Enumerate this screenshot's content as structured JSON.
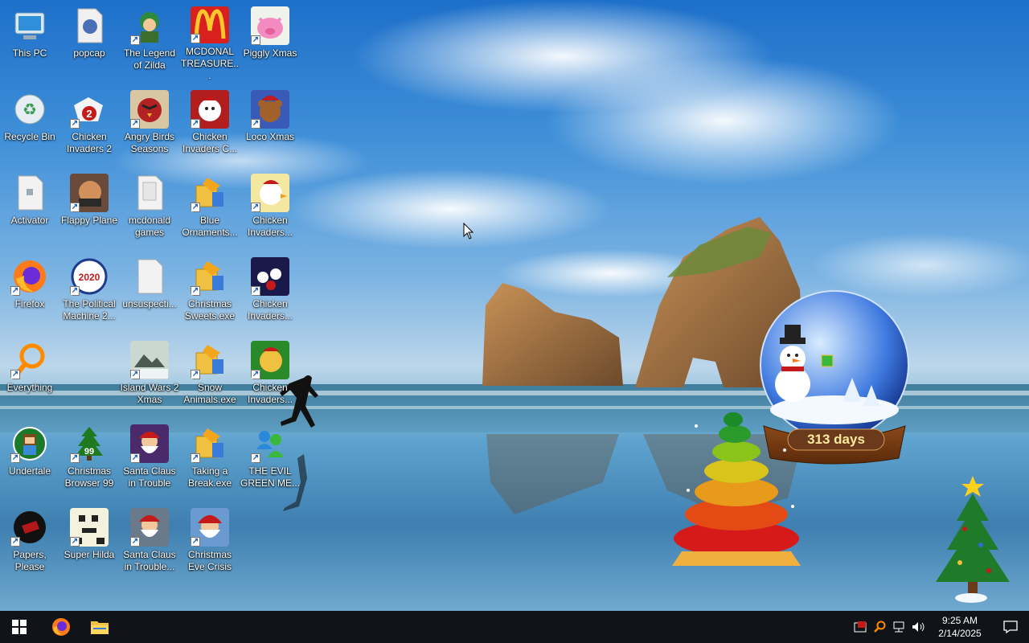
{
  "desktop_icons": [
    {
      "label": "This PC"
    },
    {
      "label": "popcap"
    },
    {
      "label": "The Legend of Zilda"
    },
    {
      "label": "MCDONAL TREASURE..."
    },
    {
      "label": "Piggly Xmas"
    },
    {
      "label": "Recycle Bin"
    },
    {
      "label": "Chicken Invaders 2"
    },
    {
      "label": "Angry Birds Seasons"
    },
    {
      "label": "Chicken Invaders C..."
    },
    {
      "label": "Loco Xmas"
    },
    {
      "label": "Activator"
    },
    {
      "label": "Flappy Plane"
    },
    {
      "label": "mcdonald games"
    },
    {
      "label": "Blue Ornaments..."
    },
    {
      "label": "Chicken Invaders..."
    },
    {
      "label": "Firefox"
    },
    {
      "label": "The Political Machine 2..."
    },
    {
      "label": "unsuspecti..."
    },
    {
      "label": "Christmas Sweets.exe"
    },
    {
      "label": "Chicken Invaders..."
    },
    {
      "label": "Everything"
    },
    {
      "label": "Island Wars 2 Xmas"
    },
    {
      "label": "Snow Animals.exe"
    },
    {
      "label": "Chicken Invaders..."
    },
    {
      "label": "Undertale"
    },
    {
      "label": "Christmas Browser 99"
    },
    {
      "label": "Santa Claus in Trouble"
    },
    {
      "label": "Taking a Break.exe"
    },
    {
      "label": "THE EVIL GREEN ME..."
    },
    {
      "label": "Papers, Please"
    },
    {
      "label": "Super Hilda"
    },
    {
      "label": "Santa Claus in Trouble..."
    },
    {
      "label": "Christmas Eve Crisis"
    }
  ],
  "icon_badges": {
    "political": "2020",
    "browser99": "99"
  },
  "gadgets": {
    "countdown": "313 days"
  },
  "taskbar": {
    "pinned": [
      "firefox-icon",
      "file-explorer-icon"
    ],
    "tray_icons": [
      "security-icon",
      "search-everything-icon",
      "network-icon",
      "volume-icon"
    ]
  },
  "clock": {
    "time": "9:25 AM",
    "date": "2/14/2025"
  },
  "colors": {
    "taskbar_bg": "#101418",
    "label_text": "#ffffff",
    "windows_blue": "#0078d7"
  }
}
